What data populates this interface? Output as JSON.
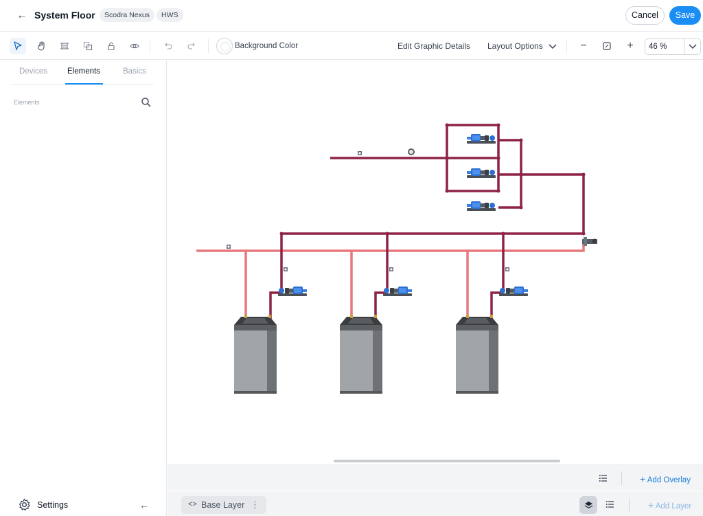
{
  "header": {
    "back_icon": "arrow-left-icon",
    "title": "System Floor",
    "site_tag": "Scodra Nexus",
    "system_tag": "HWS",
    "cancel_label": "Cancel",
    "save_label": "Save",
    "save_color": "#1a8ef5"
  },
  "toolbar": {
    "tools": [
      "pointer-icon",
      "hand-icon",
      "frame-icon",
      "group-icon",
      "lock-icon",
      "eye-icon",
      "undo-icon",
      "redo-icon"
    ],
    "background_color_label": "Background Color",
    "edit_graphic_details_label": "Edit Graphic Details",
    "layout_options_label": "Layout Options",
    "zoom_value": "46 %"
  },
  "sidebar": {
    "tabs": [
      {
        "label": "Devices",
        "active": false
      },
      {
        "label": "Elements",
        "active": true
      },
      {
        "label": "Basics",
        "active": false
      }
    ],
    "section_label": "Elements",
    "settings_label": "Settings"
  },
  "canvas": {
    "supply_pipe_color": "#8e2347",
    "return_pipe_color": "#e8787d",
    "boiler_count": 3,
    "pump_count": 6
  },
  "overlay_bar": {
    "add_overlay_label": "Add Overlay"
  },
  "layer_bar": {
    "layer_code": "<>",
    "layer_name": "Base Layer",
    "add_layer_label": "Add Layer"
  }
}
